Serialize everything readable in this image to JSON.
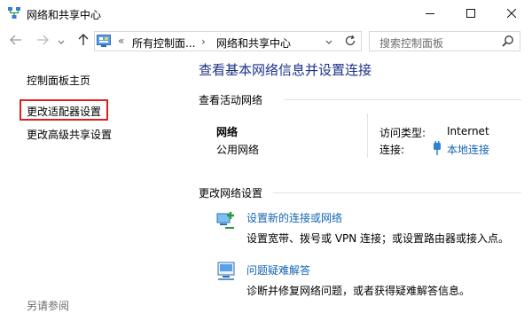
{
  "window": {
    "title": "网络和共享中心"
  },
  "address": {
    "prefix_arrows": "«",
    "crumbs": [
      "所有控制面...",
      "网络和共享中心"
    ],
    "chevron": "›",
    "search_placeholder": "搜索控制面板"
  },
  "sidebar": {
    "items": [
      {
        "label": "控制面板主页"
      },
      {
        "label": "更改适配器设置"
      },
      {
        "label": "更改高级共享设置"
      }
    ],
    "see_also": "另请参阅"
  },
  "main": {
    "title": "查看基本网络信息并设置连接",
    "active_section": "查看活动网络",
    "network": {
      "name": "网络",
      "profile": "公用网络",
      "access_type_label": "访问类型:",
      "access_type_value": "Internet",
      "connection_label": "连接:",
      "connection_value": "本地连接"
    },
    "change_section": "更改网络设置",
    "tasks": [
      {
        "title": "设置新的连接或网络",
        "description": "设置宽带、拨号或 VPN 连接；或设置路由器或接入点。"
      },
      {
        "title": "问题疑难解答",
        "description": "诊断并修复网络问题，或者获得疑难解答信息。"
      }
    ]
  },
  "colors": {
    "link": "#1464b4",
    "title": "#1e3287",
    "highlight_box": "#e0201d",
    "muted": "#6d6d6d"
  },
  "icons": [
    "network-center-icon",
    "minimize-icon",
    "maximize-icon",
    "close-icon",
    "back-arrow-icon",
    "forward-arrow-icon",
    "chevron-down-icon",
    "up-arrow-icon",
    "control-panel-icon",
    "refresh-icon",
    "search-icon",
    "plug-icon",
    "new-connection-icon",
    "troubleshoot-icon"
  ]
}
